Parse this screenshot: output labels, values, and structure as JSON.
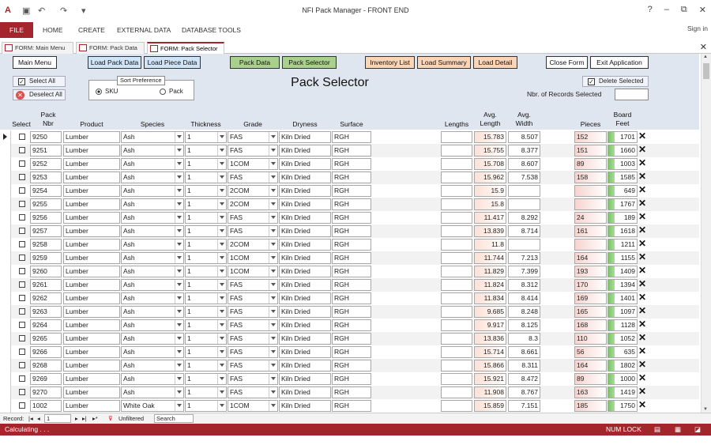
{
  "app": {
    "title": "NFI Pack Manager - FRONT END",
    "sign_in": "Sign in"
  },
  "ribbon": {
    "file": "FILE",
    "tabs": [
      "HOME",
      "CREATE",
      "EXTERNAL DATA",
      "DATABASE TOOLS"
    ]
  },
  "window_controls": [
    "?",
    "–",
    "⧉",
    "✕"
  ],
  "doc_tabs": [
    "FORM: Main Menu",
    "FORM: Pack Data",
    "FORM: Pack Selector"
  ],
  "active_doc_tab": "FORM: Pack Selector",
  "toolbar": {
    "main_menu": "Main Menu",
    "load_pack_data": "Load Pack Data",
    "load_piece_data": "Load Piece Data",
    "pack_data": "Pack Data",
    "pack_selector": "Pack Selector",
    "inventory_list": "Inventory List",
    "load_summary": "Load Summary",
    "load_detail": "Load Detail",
    "close_form": "Close Form",
    "exit_application": "Exit Application"
  },
  "select_all": "Select All",
  "deselect_all": "Deselect All",
  "sort_preference": {
    "label": "Sort Preference",
    "options": [
      "SKU",
      "Pack"
    ],
    "selected": "SKU"
  },
  "form_title": "Pack Selector",
  "delete_selected": "Delete Selected",
  "records_selected_label": "Nbr. of Records Selected",
  "columns": {
    "select": "Select",
    "pack_nbr": "Pack\nNbr",
    "product": "Product",
    "species": "Species",
    "thickness": "Thickness",
    "grade": "Grade",
    "dryness": "Dryness",
    "surface": "Surface",
    "lengths": "Lengths",
    "avg_length": "Avg.\nLength",
    "avg_width": "Avg.\nWidth",
    "pieces": "Pieces",
    "board_feet": "Board\nFeet"
  },
  "rows": [
    {
      "pack": "9250",
      "product": "Lumber",
      "species": "Ash",
      "thickness": "1",
      "grade": "FAS",
      "dryness": "Kiln Dried",
      "surface": "RGH",
      "avg_length": "15.783",
      "avg_width": "8.507",
      "pieces": "152",
      "board_feet": "1701"
    },
    {
      "pack": "9251",
      "product": "Lumber",
      "species": "Ash",
      "thickness": "1",
      "grade": "FAS",
      "dryness": "Kiln Dried",
      "surface": "RGH",
      "avg_length": "15.755",
      "avg_width": "8.377",
      "pieces": "151",
      "board_feet": "1660"
    },
    {
      "pack": "9252",
      "product": "Lumber",
      "species": "Ash",
      "thickness": "1",
      "grade": "1COM",
      "dryness": "Kiln Dried",
      "surface": "RGH",
      "avg_length": "15.708",
      "avg_width": "8.607",
      "pieces": "89",
      "board_feet": "1003"
    },
    {
      "pack": "9253",
      "product": "Lumber",
      "species": "Ash",
      "thickness": "1",
      "grade": "FAS",
      "dryness": "Kiln Dried",
      "surface": "RGH",
      "avg_length": "15.962",
      "avg_width": "7.538",
      "pieces": "158",
      "board_feet": "1585"
    },
    {
      "pack": "9254",
      "product": "Lumber",
      "species": "Ash",
      "thickness": "1",
      "grade": "2COM",
      "dryness": "Kiln Dried",
      "surface": "RGH",
      "avg_length": "15.9",
      "avg_width": "",
      "pieces": "",
      "board_feet": "649"
    },
    {
      "pack": "9255",
      "product": "Lumber",
      "species": "Ash",
      "thickness": "1",
      "grade": "2COM",
      "dryness": "Kiln Dried",
      "surface": "RGH",
      "avg_length": "15.8",
      "avg_width": "",
      "pieces": "",
      "board_feet": "1767"
    },
    {
      "pack": "9256",
      "product": "Lumber",
      "species": "Ash",
      "thickness": "1",
      "grade": "FAS",
      "dryness": "Kiln Dried",
      "surface": "RGH",
      "avg_length": "11.417",
      "avg_width": "8.292",
      "pieces": "24",
      "board_feet": "189"
    },
    {
      "pack": "9257",
      "product": "Lumber",
      "species": "Ash",
      "thickness": "1",
      "grade": "FAS",
      "dryness": "Kiln Dried",
      "surface": "RGH",
      "avg_length": "13.839",
      "avg_width": "8.714",
      "pieces": "161",
      "board_feet": "1618"
    },
    {
      "pack": "9258",
      "product": "Lumber",
      "species": "Ash",
      "thickness": "1",
      "grade": "2COM",
      "dryness": "Kiln Dried",
      "surface": "RGH",
      "avg_length": "11.8",
      "avg_width": "",
      "pieces": "",
      "board_feet": "1211"
    },
    {
      "pack": "9259",
      "product": "Lumber",
      "species": "Ash",
      "thickness": "1",
      "grade": "1COM",
      "dryness": "Kiln Dried",
      "surface": "RGH",
      "avg_length": "11.744",
      "avg_width": "7.213",
      "pieces": "164",
      "board_feet": "1155"
    },
    {
      "pack": "9260",
      "product": "Lumber",
      "species": "Ash",
      "thickness": "1",
      "grade": "1COM",
      "dryness": "Kiln Dried",
      "surface": "RGH",
      "avg_length": "11.829",
      "avg_width": "7.399",
      "pieces": "193",
      "board_feet": "1409"
    },
    {
      "pack": "9261",
      "product": "Lumber",
      "species": "Ash",
      "thickness": "1",
      "grade": "FAS",
      "dryness": "Kiln Dried",
      "surface": "RGH",
      "avg_length": "11.824",
      "avg_width": "8.312",
      "pieces": "170",
      "board_feet": "1394"
    },
    {
      "pack": "9262",
      "product": "Lumber",
      "species": "Ash",
      "thickness": "1",
      "grade": "FAS",
      "dryness": "Kiln Dried",
      "surface": "RGH",
      "avg_length": "11.834",
      "avg_width": "8.414",
      "pieces": "169",
      "board_feet": "1401"
    },
    {
      "pack": "9263",
      "product": "Lumber",
      "species": "Ash",
      "thickness": "1",
      "grade": "FAS",
      "dryness": "Kiln Dried",
      "surface": "RGH",
      "avg_length": "9.685",
      "avg_width": "8.248",
      "pieces": "165",
      "board_feet": "1097"
    },
    {
      "pack": "9264",
      "product": "Lumber",
      "species": "Ash",
      "thickness": "1",
      "grade": "FAS",
      "dryness": "Kiln Dried",
      "surface": "RGH",
      "avg_length": "9.917",
      "avg_width": "8.125",
      "pieces": "168",
      "board_feet": "1128"
    },
    {
      "pack": "9265",
      "product": "Lumber",
      "species": "Ash",
      "thickness": "1",
      "grade": "FAS",
      "dryness": "Kiln Dried",
      "surface": "RGH",
      "avg_length": "13.836",
      "avg_width": "8.3",
      "pieces": "110",
      "board_feet": "1052"
    },
    {
      "pack": "9266",
      "product": "Lumber",
      "species": "Ash",
      "thickness": "1",
      "grade": "FAS",
      "dryness": "Kiln Dried",
      "surface": "RGH",
      "avg_length": "15.714",
      "avg_width": "8.661",
      "pieces": "56",
      "board_feet": "635"
    },
    {
      "pack": "9268",
      "product": "Lumber",
      "species": "Ash",
      "thickness": "1",
      "grade": "FAS",
      "dryness": "Kiln Dried",
      "surface": "RGH",
      "avg_length": "15.866",
      "avg_width": "8.311",
      "pieces": "164",
      "board_feet": "1802"
    },
    {
      "pack": "9269",
      "product": "Lumber",
      "species": "Ash",
      "thickness": "1",
      "grade": "FAS",
      "dryness": "Kiln Dried",
      "surface": "RGH",
      "avg_length": "15.921",
      "avg_width": "8.472",
      "pieces": "89",
      "board_feet": "1000"
    },
    {
      "pack": "9270",
      "product": "Lumber",
      "species": "Ash",
      "thickness": "1",
      "grade": "FAS",
      "dryness": "Kiln Dried",
      "surface": "RGH",
      "avg_length": "11.908",
      "avg_width": "8.767",
      "pieces": "163",
      "board_feet": "1419"
    },
    {
      "pack": "1002",
      "product": "Lumber",
      "species": "White Oak",
      "thickness": "1",
      "grade": "1COM",
      "dryness": "Kiln Dried",
      "surface": "RGH",
      "avg_length": "15.859",
      "avg_width": "7.151",
      "pieces": "185",
      "board_feet": "1750"
    }
  ],
  "navigation": {
    "record_label": "Record:",
    "position": "1",
    "filter": "Unfiltered",
    "search": "Search"
  },
  "status": {
    "text": "Calculating . . .",
    "num_lock": "NUM LOCK"
  },
  "colors": {
    "accent": "#a4262c",
    "header_bg": "#dfe6ef",
    "green_button": "#a9d08e",
    "orange_button": "#fbd5b5",
    "blue_button": "#cfe5f7"
  }
}
